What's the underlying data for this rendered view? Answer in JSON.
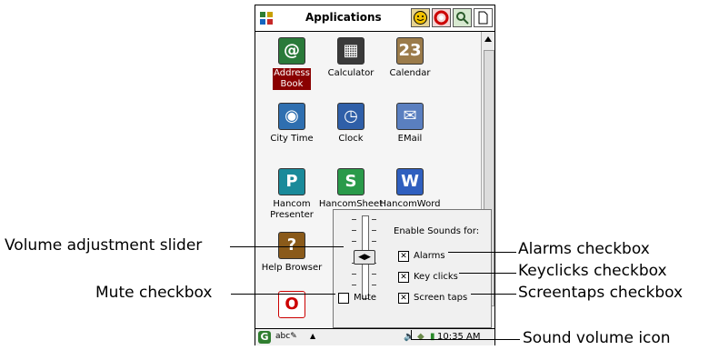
{
  "window": {
    "title": "Applications"
  },
  "titlebar_icons": [
    "smiley-icon",
    "lifebuoy-icon",
    "search-icon",
    "document-icon"
  ],
  "apps": [
    {
      "label": "Address\nBook",
      "icon": "address-book-icon",
      "color": "#2a7a3a",
      "glyph": "@",
      "selected": true
    },
    {
      "label": "Calculator",
      "icon": "calculator-icon",
      "color": "#3a3a3a",
      "glyph": "▦",
      "selected": false
    },
    {
      "label": "Calendar",
      "icon": "calendar-icon",
      "color": "#9b7b4a",
      "glyph": "23",
      "selected": false
    },
    {
      "label": "City Time",
      "icon": "globe-icon",
      "color": "#2f6fb0",
      "glyph": "◉",
      "selected": false
    },
    {
      "label": "Clock",
      "icon": "clock-icon",
      "color": "#2f5fa8",
      "glyph": "◷",
      "selected": false
    },
    {
      "label": "EMail",
      "icon": "email-icon",
      "color": "#5a7fc0",
      "glyph": "✉",
      "selected": false
    },
    {
      "label": "Hancom\nPresenter",
      "icon": "hancom-presenter-icon",
      "color": "#1a8a9a",
      "glyph": "P",
      "selected": false
    },
    {
      "label": "HancomSheet",
      "icon": "hancom-sheet-icon",
      "color": "#2a9a4a",
      "glyph": "S",
      "selected": false
    },
    {
      "label": "HancomWord",
      "icon": "hancom-word-icon",
      "color": "#2f5fbf",
      "glyph": "W",
      "selected": false
    },
    {
      "label": "Help Browser",
      "icon": "help-icon",
      "color": "#8a5a1a",
      "glyph": "?",
      "selected": false
    }
  ],
  "popup": {
    "title": "Enable Sounds for:",
    "volume_level": 0.5,
    "mute": {
      "label": "Mute",
      "checked": false
    },
    "options": [
      {
        "label": "Alarms",
        "checked": true
      },
      {
        "label": "Key clicks",
        "checked": true
      },
      {
        "label": "Screen taps",
        "checked": true
      }
    ]
  },
  "taskbar": {
    "input_mode": "abc",
    "time": "10:35 AM"
  },
  "callouts": {
    "volume_slider": "Volume adjustment slider",
    "mute": "Mute checkbox",
    "alarms": "Alarms checkbox",
    "keyclicks": "Keyclicks checkbox",
    "screentaps": "Screentaps checkbox",
    "sound_icon": "Sound volume icon"
  }
}
